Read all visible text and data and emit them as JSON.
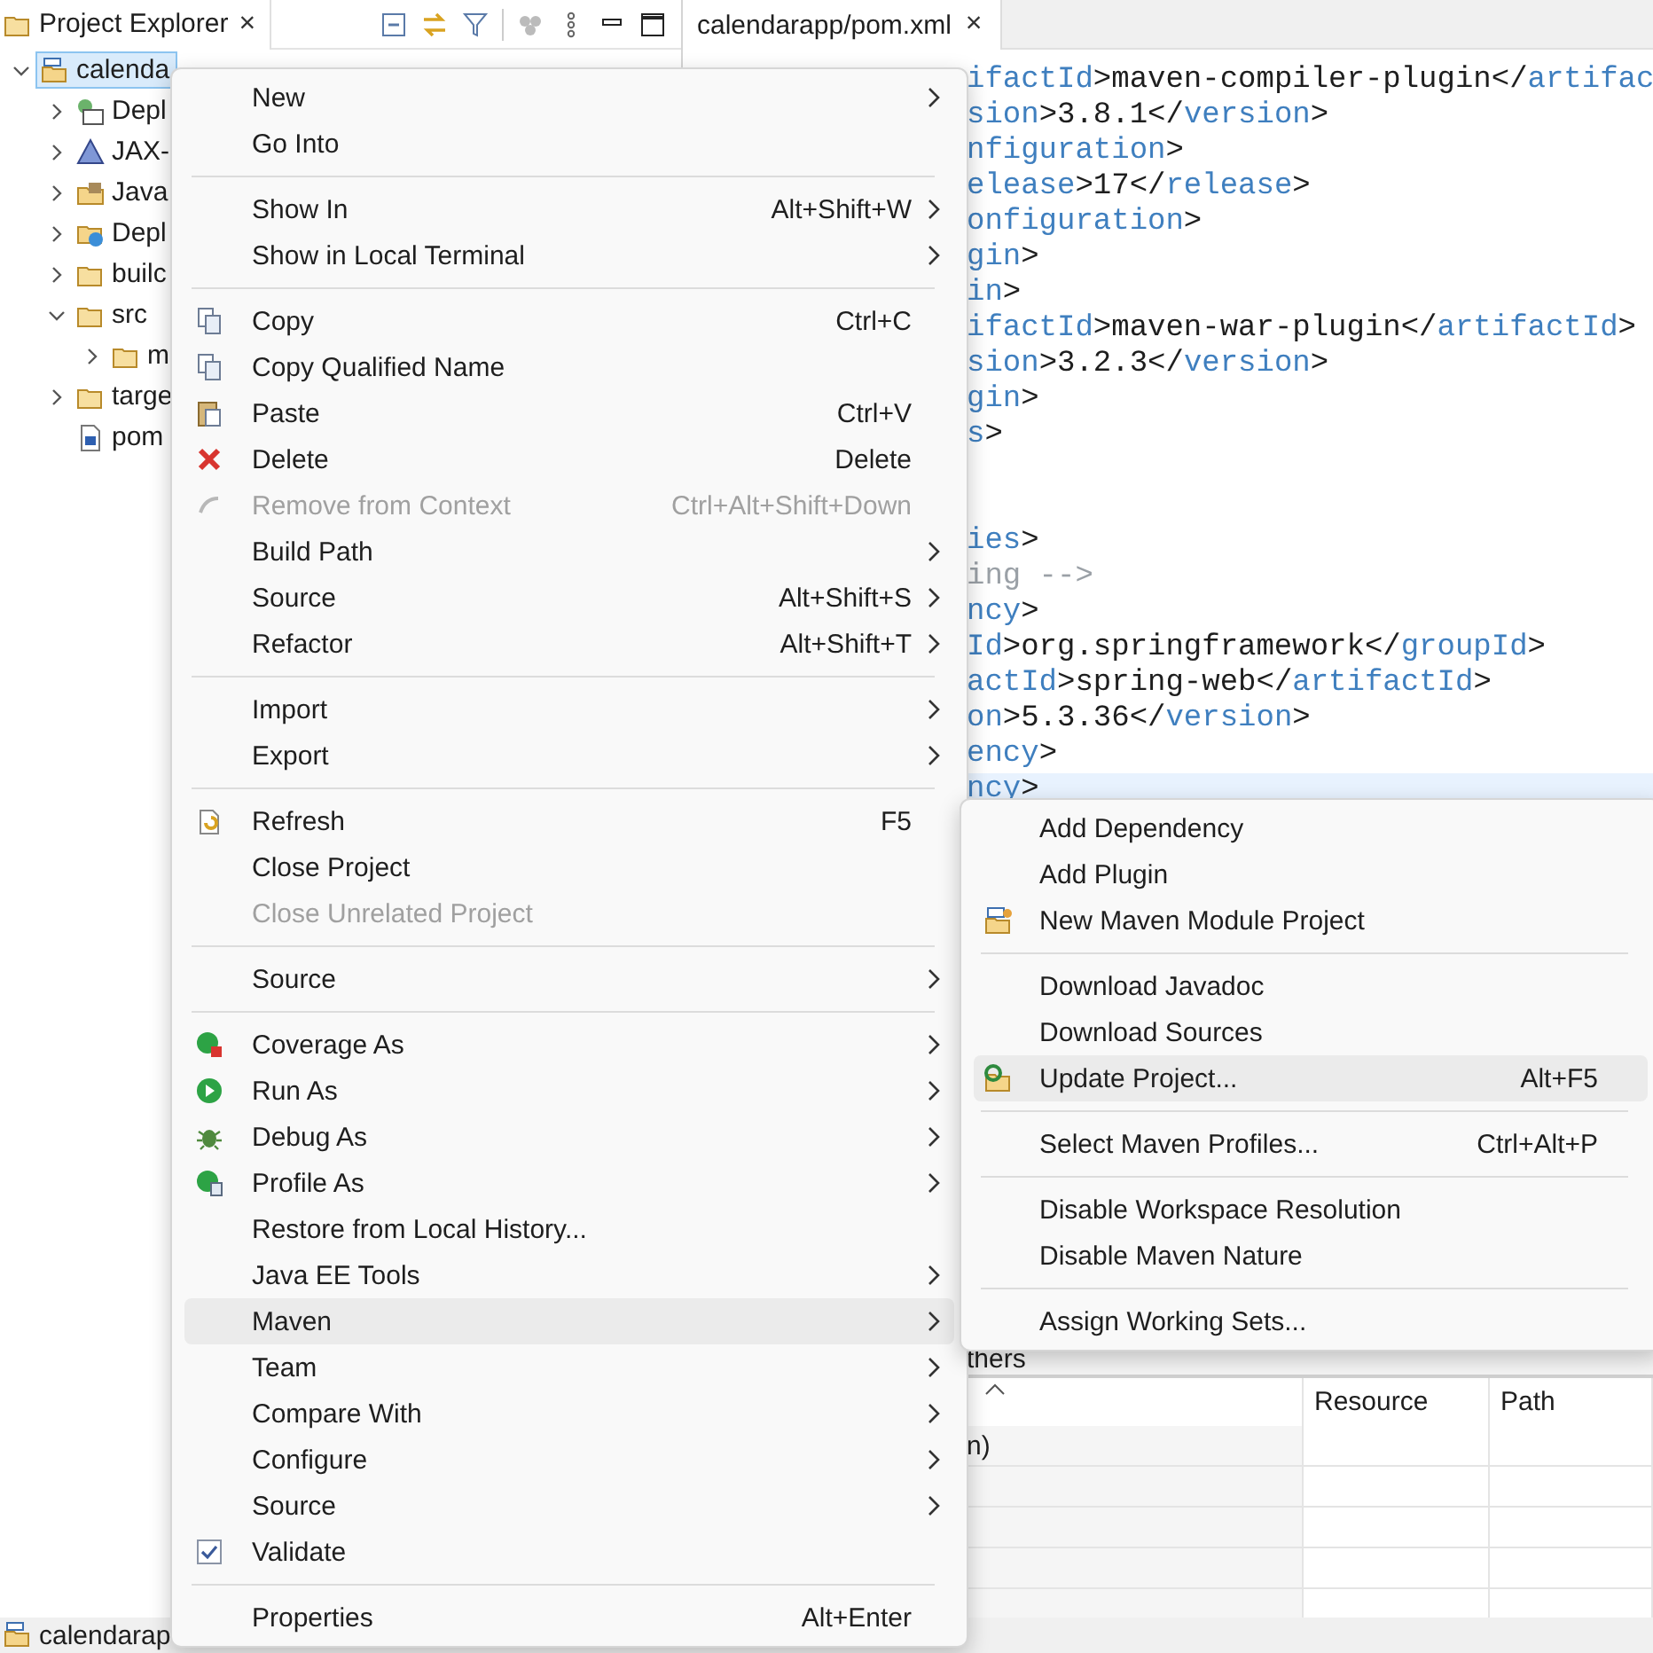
{
  "explorer": {
    "title": "Project Explorer",
    "close": "×",
    "tree": [
      {
        "label": "calenda",
        "kind": "project",
        "expanded": true,
        "selected": true,
        "children": [
          {
            "label": "Depl",
            "kind": "descriptor",
            "expanded": false,
            "selected": false
          },
          {
            "label": "JAX-",
            "kind": "webservice",
            "expanded": false,
            "selected": false
          },
          {
            "label": "Java",
            "kind": "library",
            "expanded": false,
            "selected": false
          },
          {
            "label": "Depl",
            "kind": "deployed",
            "expanded": false,
            "selected": false
          },
          {
            "label": "builc",
            "kind": "folder",
            "expanded": false,
            "selected": false
          },
          {
            "label": "src",
            "kind": "folder",
            "expanded": true,
            "selected": false,
            "children": [
              {
                "label": "m",
                "kind": "folder",
                "expanded": false,
                "selected": false
              }
            ]
          },
          {
            "label": "targe",
            "kind": "folder",
            "expanded": false,
            "selected": false
          },
          {
            "label": "pom",
            "kind": "file",
            "selected": false
          }
        ]
      }
    ]
  },
  "editor": {
    "tab": "calendarapp/pom.xml",
    "close": "×",
    "lines": [
      {
        "highlighted": false,
        "segments": [
          {
            "kind": "tag",
            "text": "ifactId"
          },
          {
            "kind": "punct",
            "text": ">"
          },
          {
            "kind": "text",
            "text": "maven-compiler-plugin"
          },
          {
            "kind": "punct",
            "text": "</"
          },
          {
            "kind": "tag",
            "text": "artifac"
          }
        ]
      },
      {
        "highlighted": false,
        "segments": [
          {
            "kind": "tag",
            "text": "sion"
          },
          {
            "kind": "punct",
            "text": ">"
          },
          {
            "kind": "text",
            "text": "3.8.1"
          },
          {
            "kind": "punct",
            "text": "</"
          },
          {
            "kind": "tag",
            "text": "version"
          },
          {
            "kind": "punct",
            "text": ">"
          }
        ]
      },
      {
        "highlighted": false,
        "segments": [
          {
            "kind": "tag",
            "text": "nfiguration"
          },
          {
            "kind": "punct",
            "text": ">"
          }
        ]
      },
      {
        "highlighted": false,
        "segments": [
          {
            "kind": "tag",
            "text": "elease"
          },
          {
            "kind": "punct",
            "text": ">"
          },
          {
            "kind": "text",
            "text": "17"
          },
          {
            "kind": "punct",
            "text": "</"
          },
          {
            "kind": "tag",
            "text": "release"
          },
          {
            "kind": "punct",
            "text": ">"
          }
        ]
      },
      {
        "highlighted": false,
        "segments": [
          {
            "kind": "tag",
            "text": "onfiguration"
          },
          {
            "kind": "punct",
            "text": ">"
          }
        ]
      },
      {
        "highlighted": false,
        "segments": [
          {
            "kind": "tag",
            "text": "gin"
          },
          {
            "kind": "punct",
            "text": ">"
          }
        ]
      },
      {
        "highlighted": false,
        "segments": [
          {
            "kind": "tag",
            "text": "in"
          },
          {
            "kind": "punct",
            "text": ">"
          }
        ]
      },
      {
        "highlighted": false,
        "segments": [
          {
            "kind": "tag",
            "text": "ifactId"
          },
          {
            "kind": "punct",
            "text": ">"
          },
          {
            "kind": "text",
            "text": "maven-war-plugin"
          },
          {
            "kind": "punct",
            "text": "</"
          },
          {
            "kind": "tag",
            "text": "artifactId"
          },
          {
            "kind": "punct",
            "text": ">"
          }
        ]
      },
      {
        "highlighted": false,
        "segments": [
          {
            "kind": "tag",
            "text": "sion"
          },
          {
            "kind": "punct",
            "text": ">"
          },
          {
            "kind": "text",
            "text": "3.2.3"
          },
          {
            "kind": "punct",
            "text": "</"
          },
          {
            "kind": "tag",
            "text": "version"
          },
          {
            "kind": "punct",
            "text": ">"
          }
        ]
      },
      {
        "highlighted": false,
        "segments": [
          {
            "kind": "tag",
            "text": "gin"
          },
          {
            "kind": "punct",
            "text": ">"
          }
        ]
      },
      {
        "highlighted": false,
        "segments": [
          {
            "kind": "tag",
            "text": "s"
          },
          {
            "kind": "punct",
            "text": ">"
          }
        ]
      },
      {
        "highlighted": false
      },
      {
        "highlighted": false
      },
      {
        "highlighted": false,
        "segments": [
          {
            "kind": "tag",
            "text": "ies"
          },
          {
            "kind": "punct",
            "text": ">"
          }
        ]
      },
      {
        "highlighted": false,
        "segments": [
          {
            "kind": "comment",
            "text": "ing -->"
          }
        ]
      },
      {
        "highlighted": false,
        "segments": [
          {
            "kind": "tag",
            "text": "ncy"
          },
          {
            "kind": "punct",
            "text": ">"
          }
        ]
      },
      {
        "highlighted": false,
        "segments": [
          {
            "kind": "tag",
            "text": "Id"
          },
          {
            "kind": "punct",
            "text": ">"
          },
          {
            "kind": "text",
            "text": "org.springframework"
          },
          {
            "kind": "punct",
            "text": "</"
          },
          {
            "kind": "tag",
            "text": "groupId"
          },
          {
            "kind": "punct",
            "text": ">"
          }
        ]
      },
      {
        "highlighted": false,
        "segments": [
          {
            "kind": "tag",
            "text": "actId"
          },
          {
            "kind": "punct",
            "text": ">"
          },
          {
            "kind": "text",
            "text": "spring-web"
          },
          {
            "kind": "punct",
            "text": "</"
          },
          {
            "kind": "tag",
            "text": "artifactId"
          },
          {
            "kind": "punct",
            "text": ">"
          }
        ]
      },
      {
        "highlighted": false,
        "segments": [
          {
            "kind": "tag",
            "text": "on"
          },
          {
            "kind": "punct",
            "text": ">"
          },
          {
            "kind": "text",
            "text": "5.3.36"
          },
          {
            "kind": "punct",
            "text": "</"
          },
          {
            "kind": "tag",
            "text": "version"
          },
          {
            "kind": "punct",
            "text": ">"
          }
        ]
      },
      {
        "highlighted": false,
        "segments": [
          {
            "kind": "tag",
            "text": "ency"
          },
          {
            "kind": "punct",
            "text": ">"
          }
        ]
      },
      {
        "highlighted": true,
        "segments": [
          {
            "kind": "tag",
            "text": "ncy"
          },
          {
            "kind": "punct",
            "text": ">"
          }
        ]
      }
    ]
  },
  "bottom_panel": {
    "tab": "thers",
    "columns": [
      {
        "sorted": true
      },
      {
        "label": "Resource",
        "sorted": false
      },
      {
        "label": "Path",
        "sorted": false
      }
    ],
    "rows": [
      {
        "cells": [
          "n)"
        ]
      }
    ]
  },
  "status_bar": {
    "text": "calendarap"
  },
  "context_menu": {
    "items": [
      {
        "kind": "item",
        "label": "New",
        "submenu": true,
        "selected": false,
        "disabled": false
      },
      {
        "kind": "item",
        "label": "Go Into",
        "submenu": false,
        "selected": false,
        "disabled": false
      },
      {
        "kind": "separator"
      },
      {
        "kind": "item",
        "label": "Show In",
        "shortcut": "Alt+Shift+W",
        "submenu": true,
        "selected": false,
        "disabled": false
      },
      {
        "kind": "item",
        "label": "Show in Local Terminal",
        "submenu": true,
        "selected": false,
        "disabled": false
      },
      {
        "kind": "separator"
      },
      {
        "kind": "copy",
        "label": "Copy",
        "shortcut": "Ctrl+C",
        "submenu": false,
        "selected": false,
        "disabled": false
      },
      {
        "kind": "copy",
        "label": "Copy Qualified Name",
        "submenu": false,
        "selected": false,
        "disabled": false
      },
      {
        "kind": "paste",
        "label": "Paste",
        "shortcut": "Ctrl+V",
        "submenu": false,
        "selected": false,
        "disabled": false
      },
      {
        "kind": "delete",
        "label": "Delete",
        "shortcut": "Delete",
        "submenu": false,
        "selected": false,
        "disabled": false
      },
      {
        "kind": "remove",
        "label": "Remove from Context",
        "shortcut": "Ctrl+Alt+Shift+Down",
        "submenu": false,
        "selected": false,
        "disabled": true
      },
      {
        "kind": "item",
        "label": "Build Path",
        "submenu": true,
        "selected": false,
        "disabled": false
      },
      {
        "kind": "item",
        "label": "Source",
        "shortcut": "Alt+Shift+S",
        "submenu": true,
        "selected": false,
        "disabled": false
      },
      {
        "kind": "item",
        "label": "Refactor",
        "shortcut": "Alt+Shift+T",
        "submenu": true,
        "selected": false,
        "disabled": false
      },
      {
        "kind": "separator"
      },
      {
        "kind": "item",
        "label": "Import",
        "submenu": true,
        "selected": false,
        "disabled": false
      },
      {
        "kind": "item",
        "label": "Export",
        "submenu": true,
        "selected": false,
        "disabled": false
      },
      {
        "kind": "separator"
      },
      {
        "kind": "refresh",
        "label": "Refresh",
        "shortcut": "F5",
        "submenu": false,
        "selected": false,
        "disabled": false
      },
      {
        "kind": "item",
        "label": "Close Project",
        "submenu": false,
        "selected": false,
        "disabled": false
      },
      {
        "kind": "item",
        "label": "Close Unrelated Project",
        "submenu": false,
        "selected": false,
        "disabled": true
      },
      {
        "kind": "separator"
      },
      {
        "kind": "item",
        "label": "Source",
        "submenu": true,
        "selected": false,
        "disabled": false
      },
      {
        "kind": "separator"
      },
      {
        "kind": "coverage",
        "label": "Coverage As",
        "submenu": true,
        "selected": false,
        "disabled": false
      },
      {
        "kind": "run",
        "label": "Run As",
        "submenu": true,
        "selected": false,
        "disabled": false
      },
      {
        "kind": "debug",
        "label": "Debug As",
        "submenu": true,
        "selected": false,
        "disabled": false
      },
      {
        "kind": "profile",
        "label": "Profile As",
        "submenu": true,
        "selected": false,
        "disabled": false
      },
      {
        "kind": "item",
        "label": "Restore from Local History...",
        "submenu": false,
        "selected": false,
        "disabled": false
      },
      {
        "kind": "item",
        "label": "Java EE Tools",
        "submenu": true,
        "selected": false,
        "disabled": false
      },
      {
        "kind": "item",
        "label": "Maven",
        "submenu": true,
        "selected": true,
        "disabled": false
      },
      {
        "kind": "item",
        "label": "Team",
        "submenu": true,
        "selected": false,
        "disabled": false
      },
      {
        "kind": "item",
        "label": "Compare With",
        "submenu": true,
        "selected": false,
        "disabled": false
      },
      {
        "kind": "item",
        "label": "Configure",
        "submenu": true,
        "selected": false,
        "disabled": false
      },
      {
        "kind": "item",
        "label": "Source",
        "submenu": true,
        "selected": false,
        "disabled": false
      },
      {
        "kind": "check",
        "label": "Validate",
        "checked": true,
        "submenu": false,
        "selected": false,
        "disabled": false
      },
      {
        "kind": "separator"
      },
      {
        "kind": "item",
        "label": "Properties",
        "shortcut": "Alt+Enter",
        "submenu": false,
        "selected": false,
        "disabled": false
      }
    ]
  },
  "maven_submenu": {
    "items": [
      {
        "kind": "item",
        "label": "Add Dependency",
        "selected": false,
        "disabled": false
      },
      {
        "kind": "item",
        "label": "Add Plugin",
        "selected": false,
        "disabled": false
      },
      {
        "kind": "module",
        "label": "New Maven Module Project",
        "selected": false,
        "disabled": false
      },
      {
        "kind": "separator"
      },
      {
        "kind": "item",
        "label": "Download Javadoc",
        "selected": false,
        "disabled": false
      },
      {
        "kind": "item",
        "label": "Download Sources",
        "selected": false,
        "disabled": false
      },
      {
        "kind": "update",
        "label": "Update Project...",
        "shortcut": "Alt+F5",
        "selected": true,
        "disabled": false
      },
      {
        "kind": "separator"
      },
      {
        "kind": "item",
        "label": "Select Maven Profiles...",
        "shortcut": "Ctrl+Alt+P",
        "selected": false,
        "disabled": false
      },
      {
        "kind": "separator"
      },
      {
        "kind": "item",
        "label": "Disable Workspace Resolution",
        "selected": false,
        "disabled": false
      },
      {
        "kind": "item",
        "label": "Disable Maven Nature",
        "selected": false,
        "disabled": false
      },
      {
        "kind": "separator"
      },
      {
        "kind": "item",
        "label": "Assign Working Sets...",
        "selected": false,
        "disabled": false
      }
    ]
  }
}
